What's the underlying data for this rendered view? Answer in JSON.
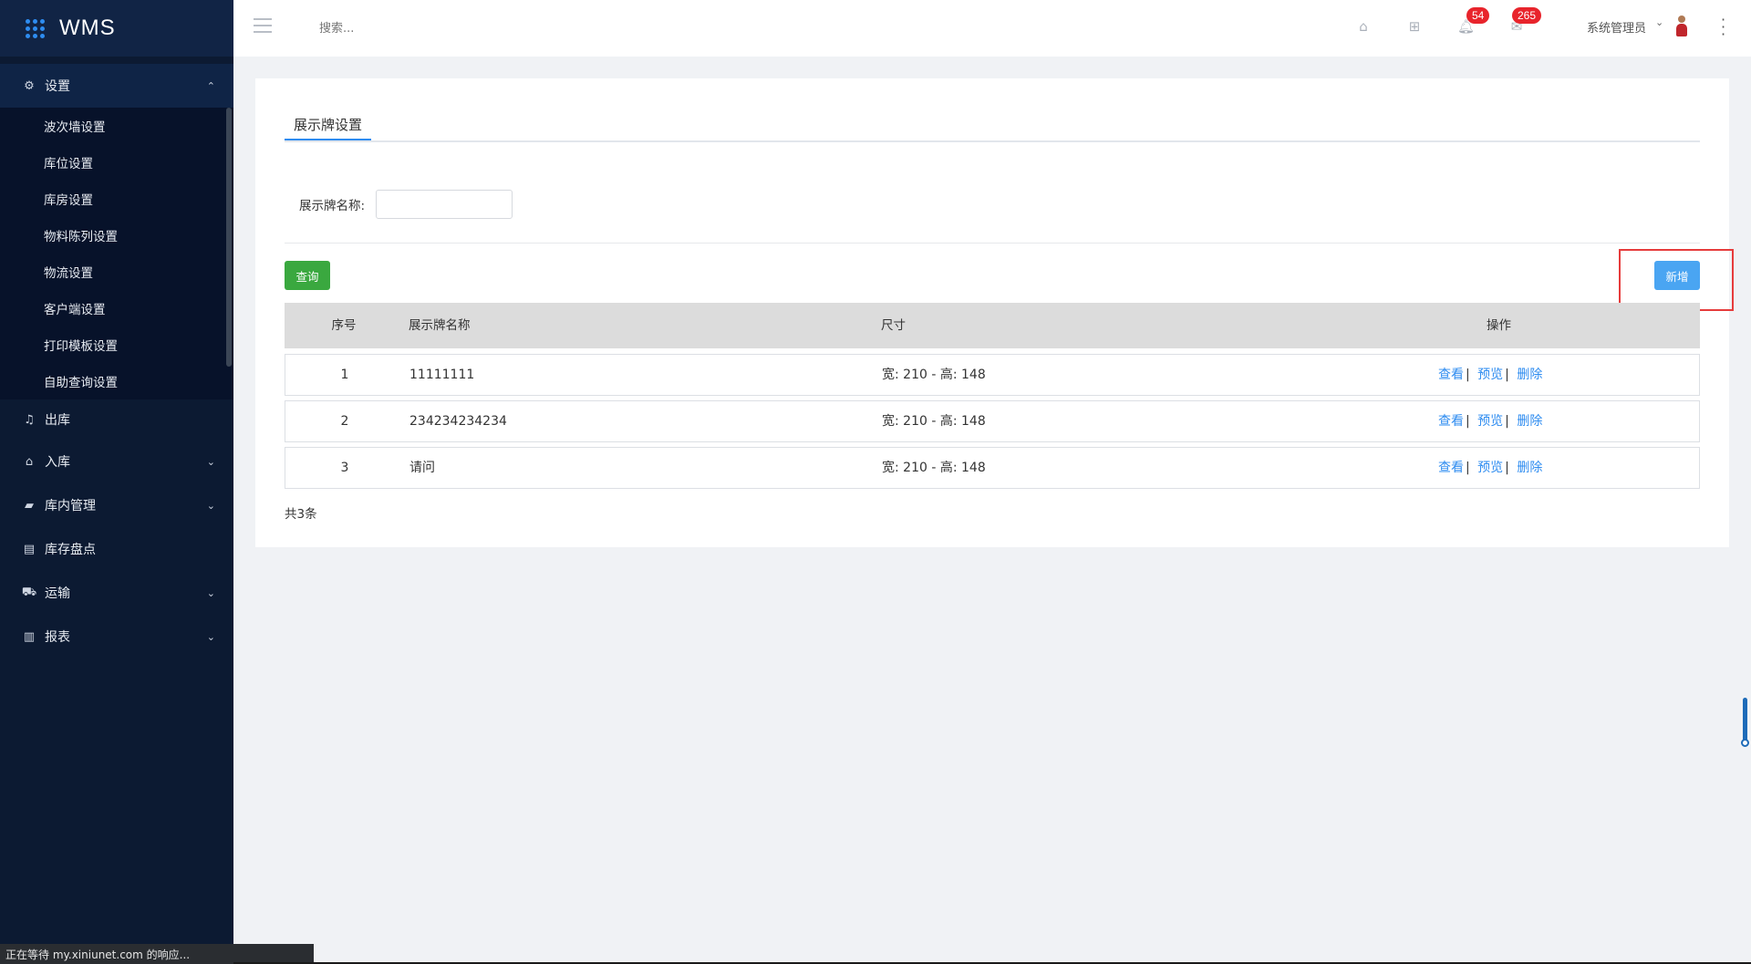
{
  "app": {
    "name": "WMS"
  },
  "sidebar": {
    "settings": {
      "label": "设置",
      "items": [
        "波次墙设置",
        "库位设置",
        "库房设置",
        "物料陈列设置",
        "物流设置",
        "客户端设置",
        "打印模板设置",
        "自助查询设置"
      ]
    },
    "outbound": "出库",
    "inbound": "入库",
    "warehouse": "库内管理",
    "inventory": "库存盘点",
    "transport": "运输",
    "reports": "报表"
  },
  "header": {
    "search_placeholder": "搜索...",
    "bell_count": "54",
    "message_count": "265",
    "user_name": "系统管理员"
  },
  "page": {
    "tab": "展示牌设置",
    "filter_label": "展示牌名称:",
    "filter_value": "",
    "query_button": "查询",
    "add_button": "新增",
    "table": {
      "headers": [
        "序号",
        "展示牌名称",
        "尺寸",
        "操作"
      ],
      "rows": [
        {
          "idx": "1",
          "name": "11111111",
          "size": "宽: 210 - 高: 148"
        },
        {
          "idx": "2",
          "name": "234234234234",
          "size": "宽: 210 - 高: 148"
        },
        {
          "idx": "3",
          "name": "请问",
          "size": "宽: 210 - 高: 148"
        }
      ],
      "ops": {
        "view": "查看",
        "preview": "预览",
        "delete": "删除",
        "sep": "|"
      }
    },
    "total": "共3条"
  },
  "status_bar": "正在等待 my.xiniunet.com 的响应...",
  "colors": {
    "sidebar_bg": "#0c1a32",
    "primary": "#2e8cf0",
    "query_green": "#3aa83f",
    "add_blue": "#4aa5f2",
    "badge_red": "#e8242c",
    "highlight_red": "#e63c3c"
  }
}
